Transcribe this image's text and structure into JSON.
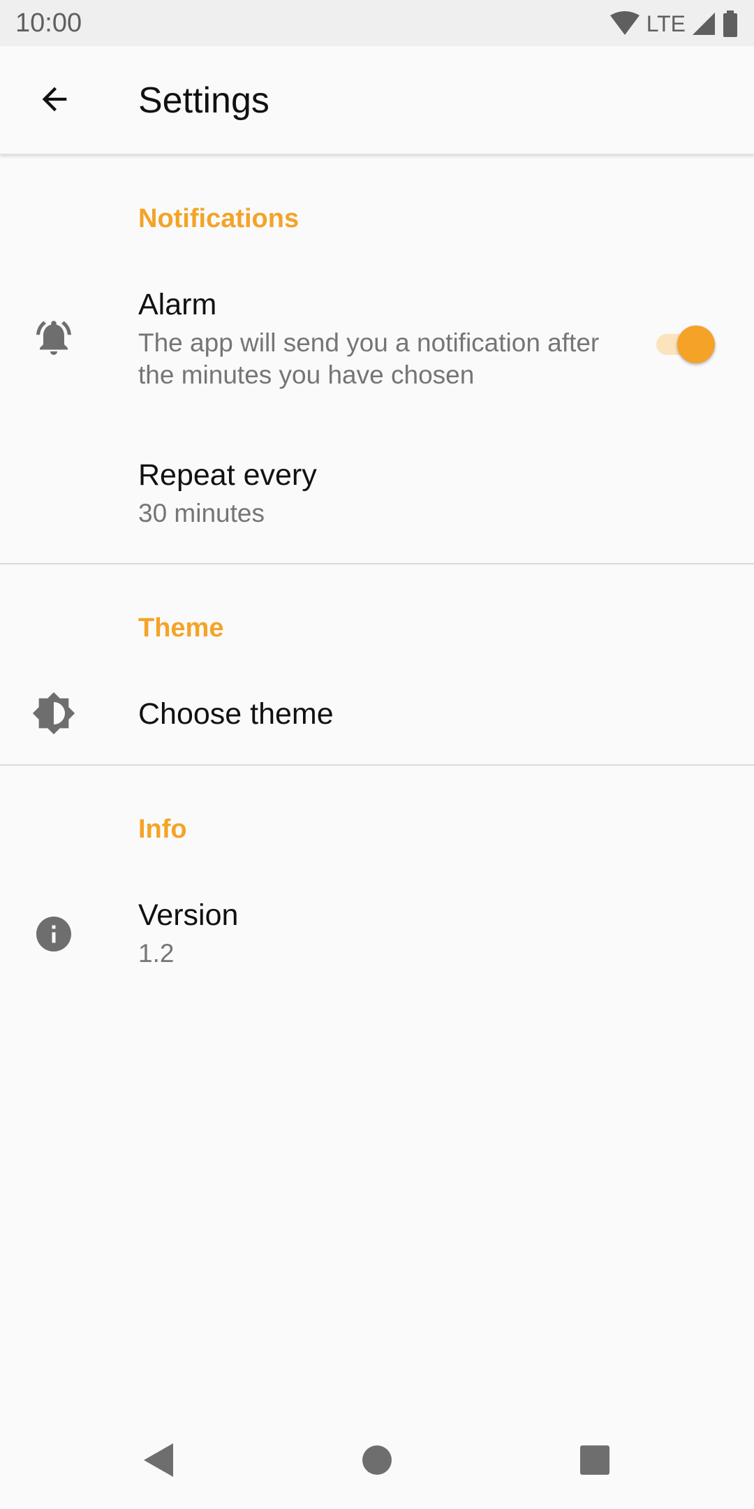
{
  "status_bar": {
    "time": "10:00",
    "network": "LTE",
    "icons": [
      "wifi-icon",
      "signal-icon",
      "battery-icon"
    ]
  },
  "app_bar": {
    "title": "Settings",
    "back_icon": "arrow-back-icon"
  },
  "sections": {
    "notifications": {
      "header": "Notifications",
      "alarm": {
        "title": "Alarm",
        "summary": "The app will send you a notification after the minutes you have chosen",
        "icon": "bell-ringing-icon",
        "toggle_on": true
      },
      "repeat": {
        "title": "Repeat every",
        "summary": "30 minutes"
      }
    },
    "theme": {
      "header": "Theme",
      "choose_theme": {
        "title": "Choose theme",
        "icon": "brightness-icon"
      }
    },
    "info": {
      "header": "Info",
      "version": {
        "title": "Version",
        "summary": "1.2",
        "icon": "info-icon"
      }
    }
  },
  "nav_bar": {
    "icons": [
      "nav-back-icon",
      "nav-home-icon",
      "nav-recents-icon"
    ]
  },
  "colors": {
    "accent": "#f4a328",
    "accent_light": "#fbe3bd",
    "text_primary": "#111111",
    "text_secondary": "#757575",
    "icon": "#6e6e6e"
  }
}
